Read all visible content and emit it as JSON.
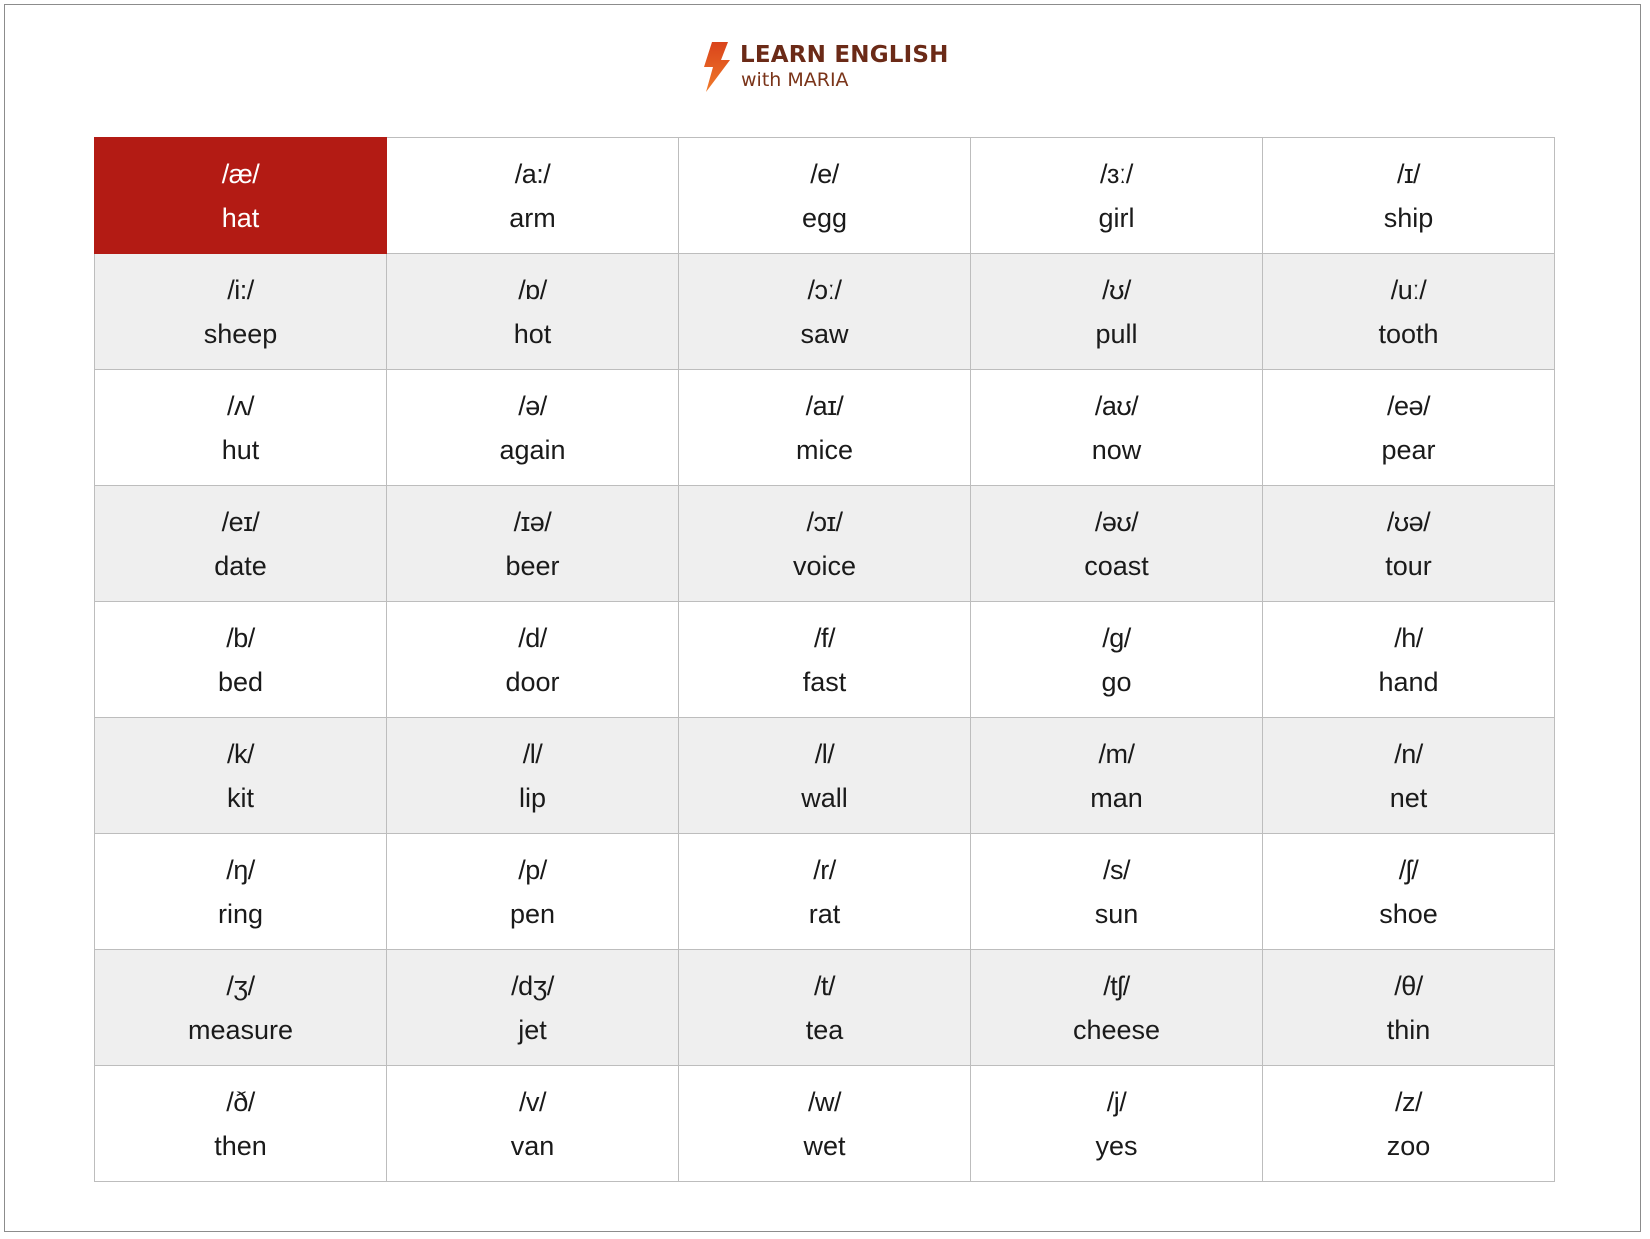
{
  "logo": {
    "icon": "lightning-bolt-icon",
    "line1": "LEARN ENGLISH",
    "line2": "with MARIA",
    "colors": {
      "bolt": "#e8591e",
      "text": "#6b2a17"
    }
  },
  "colors": {
    "highlight": "#b31b14",
    "row_alt": "#efefef",
    "border": "#bdbdbd"
  },
  "selected": {
    "row": 0,
    "col": 0
  },
  "rows": [
    [
      {
        "symbol": "/æ/",
        "word": "hat"
      },
      {
        "symbol": "/a:/",
        "word": "arm"
      },
      {
        "symbol": "/e/",
        "word": "egg"
      },
      {
        "symbol": "/ɜː/",
        "word": "girl"
      },
      {
        "symbol": "/ɪ/",
        "word": "ship"
      }
    ],
    [
      {
        "symbol": "/i:/",
        "word": "sheep"
      },
      {
        "symbol": "/ɒ/",
        "word": "hot"
      },
      {
        "symbol": "/ɔː/",
        "word": "saw"
      },
      {
        "symbol": "/ʊ/",
        "word": "pull"
      },
      {
        "symbol": "/uː/",
        "word": "tooth"
      }
    ],
    [
      {
        "symbol": "/ʌ/",
        "word": "hut"
      },
      {
        "symbol": "/ə/",
        "word": "again"
      },
      {
        "symbol": "/aɪ/",
        "word": "mice"
      },
      {
        "symbol": "/aʊ/",
        "word": "now"
      },
      {
        "symbol": "/eə/",
        "word": "pear"
      }
    ],
    [
      {
        "symbol": "/eɪ/",
        "word": "date"
      },
      {
        "symbol": "/ɪə/",
        "word": "beer"
      },
      {
        "symbol": "/ɔɪ/",
        "word": "voice"
      },
      {
        "symbol": "/əʊ/",
        "word": "coast"
      },
      {
        "symbol": "/ʊə/",
        "word": "tour"
      }
    ],
    [
      {
        "symbol": "/b/",
        "word": "bed"
      },
      {
        "symbol": "/d/",
        "word": "door"
      },
      {
        "symbol": "/f/",
        "word": "fast"
      },
      {
        "symbol": "/g/",
        "word": "go"
      },
      {
        "symbol": "/h/",
        "word": "hand"
      }
    ],
    [
      {
        "symbol": "/k/",
        "word": "kit"
      },
      {
        "symbol": "/l/",
        "word": "lip"
      },
      {
        "symbol": "/l/",
        "word": "wall"
      },
      {
        "symbol": "/m/",
        "word": "man"
      },
      {
        "symbol": "/n/",
        "word": "net"
      }
    ],
    [
      {
        "symbol": "/ŋ/",
        "word": "ring"
      },
      {
        "symbol": "/p/",
        "word": "pen"
      },
      {
        "symbol": "/r/",
        "word": "rat"
      },
      {
        "symbol": "/s/",
        "word": "sun"
      },
      {
        "symbol": "/ʃ/",
        "word": "shoe"
      }
    ],
    [
      {
        "symbol": "/ʒ/",
        "word": "measure"
      },
      {
        "symbol": "/dʒ/",
        "word": "jet"
      },
      {
        "symbol": "/t/",
        "word": "tea"
      },
      {
        "symbol": "/tʃ/",
        "word": "cheese"
      },
      {
        "symbol": "/θ/",
        "word": "thin"
      }
    ],
    [
      {
        "symbol": "/ð/",
        "word": "then"
      },
      {
        "symbol": "/v/",
        "word": "van"
      },
      {
        "symbol": "/w/",
        "word": "wet"
      },
      {
        "symbol": "/j/",
        "word": "yes"
      },
      {
        "symbol": "/z/",
        "word": "zoo"
      }
    ]
  ]
}
